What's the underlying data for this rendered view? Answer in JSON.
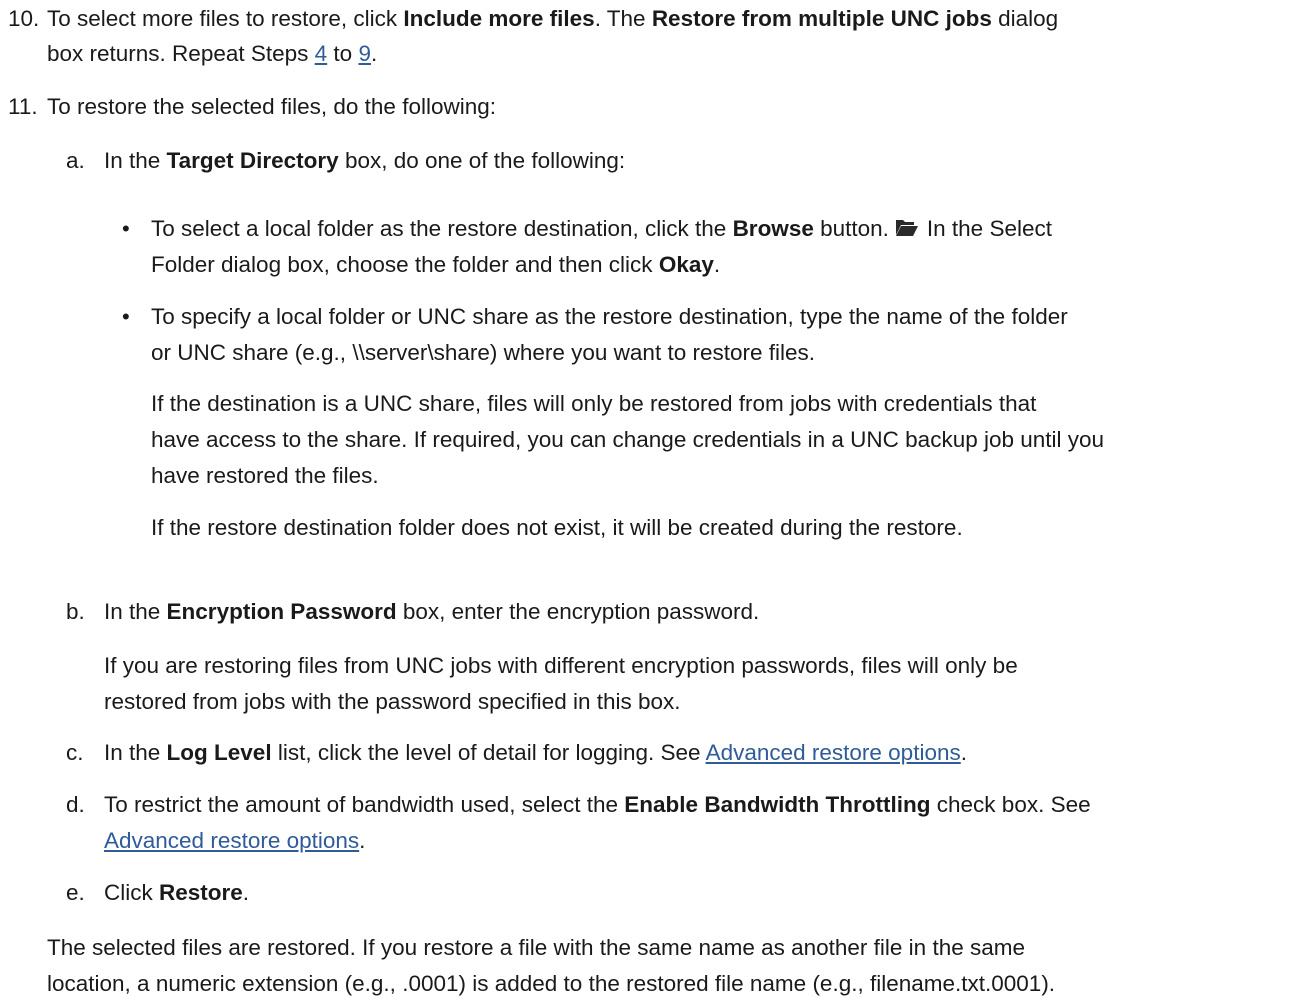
{
  "step10": {
    "num": "10.",
    "t1": "To select more files to restore, click ",
    "b1": "Include more files",
    "t2": ". The ",
    "b2": "Restore from multiple UNC jobs",
    "t3": " dialog",
    "l2a": "box returns. Repeat Steps ",
    "link4": "4",
    "l2b": " to ",
    "link9": "9",
    "l2c": "."
  },
  "step11": {
    "num": "11.",
    "text": "To restore the selected files, do the following:"
  },
  "a": {
    "letter": "a.",
    "t1": "In the ",
    "b1": "Target Directory",
    "t2": " box, do one of the following:",
    "bullet1": {
      "t1": "To select a local folder as the restore destination, click the ",
      "b1": "Browse",
      "t2": " button.",
      "t3": "In the Select",
      "l2a": "Folder dialog box, choose the folder and then click ",
      "b2": "Okay",
      "l2b": "."
    },
    "bullet2": {
      "l1": "To specify a local folder or UNC share as the restore destination, type the name of the folder",
      "l2": "or UNC share (e.g., \\\\server\\share) where you want to restore files.",
      "p1l1": "If the destination is a UNC share, files will only be restored from jobs with credentials that",
      "p1l2": "have access to the share. If required, you can change credentials in a UNC backup job until you",
      "p1l3": "have restored the files.",
      "p2": "If the restore destination folder does not exist, it will be created during the restore."
    }
  },
  "b": {
    "letter": "b.",
    "t1": "In the ",
    "b1": "Encryption Password",
    "t2": " box, enter the encryption password.",
    "p1": "If you are restoring files from UNC jobs with different encryption passwords, files will only be",
    "p2": "restored from jobs with the password specified in this box."
  },
  "c": {
    "letter": "c.",
    "t1": "In the ",
    "b1": "Log Level",
    "t2": " list, click the level of detail for logging. See ",
    "link": "Advanced restore options",
    "t3": "."
  },
  "d": {
    "letter": "d.",
    "t1": "To restrict the amount of bandwidth used, select the ",
    "b1": "Enable Bandwidth Throttling",
    "t2": " check box. See",
    "link": "Advanced restore options",
    "t3": "."
  },
  "e": {
    "letter": "e.",
    "t1": "Click ",
    "b1": "Restore",
    "t2": "."
  },
  "closing": {
    "l1": "The selected files are restored. If you restore a file with the same name as another file in the same",
    "l2": "location, a numeric extension (e.g., .0001) is added to the restored file name (e.g., filename.txt.0001)."
  },
  "icons": {
    "browse": "folder-open-icon"
  },
  "colors": {
    "link": "#2f5b9a",
    "text": "#1a1a1a"
  }
}
